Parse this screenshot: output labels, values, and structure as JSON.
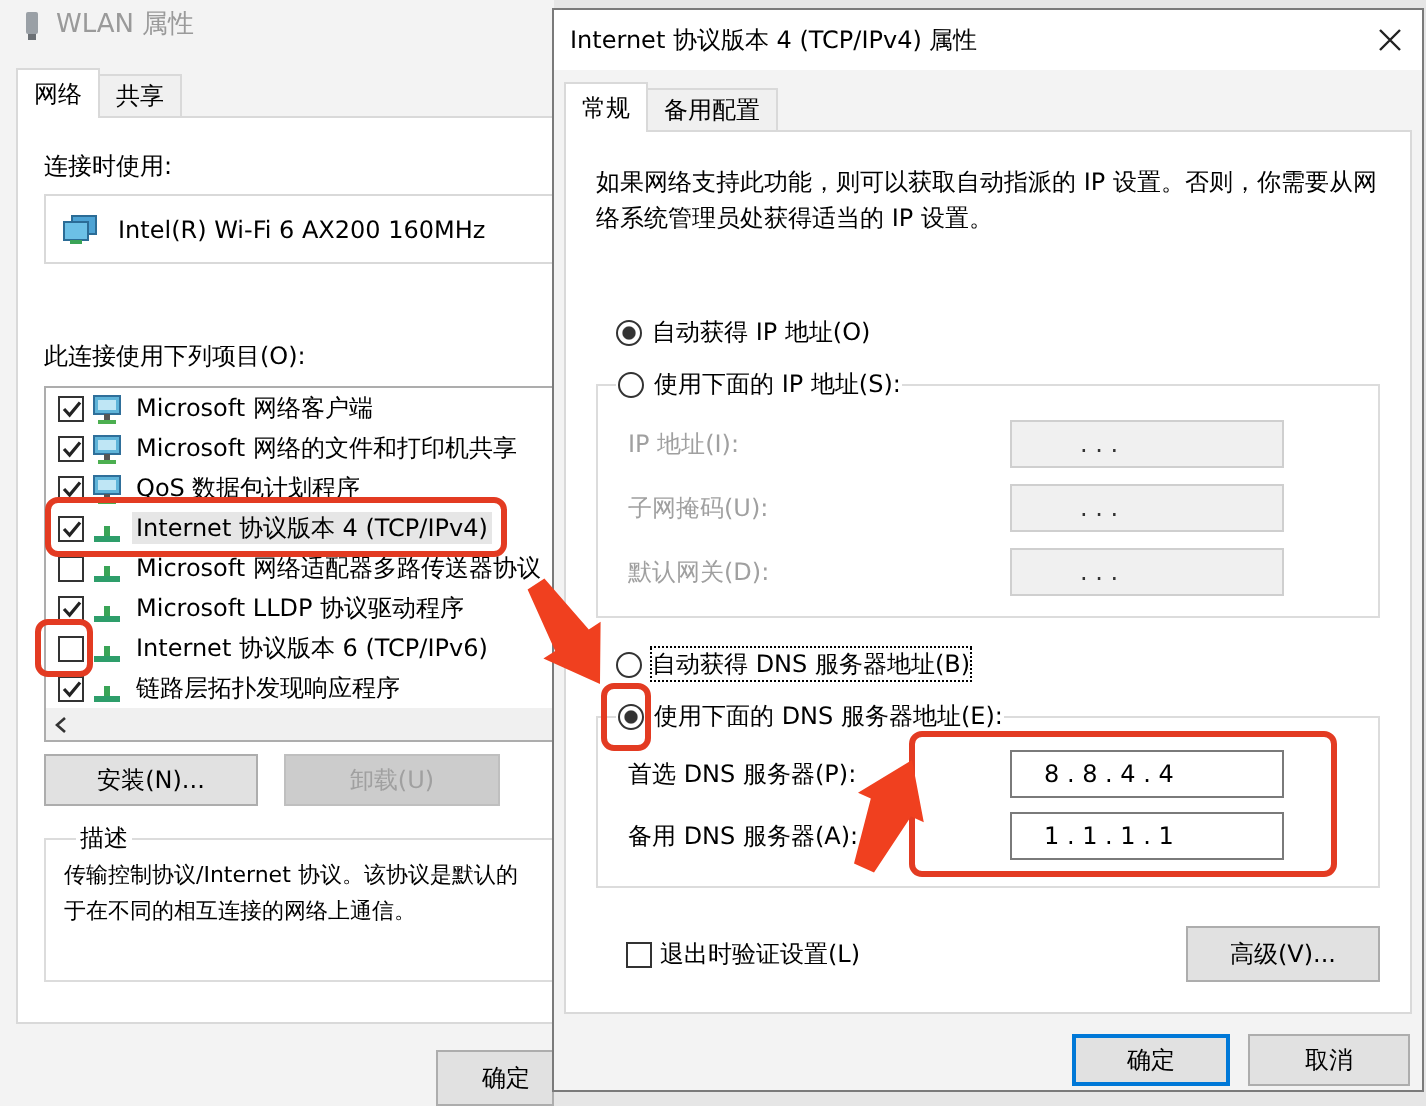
{
  "wlan_window": {
    "title": "WLAN 属性",
    "tabs": [
      {
        "label": "网络",
        "selected": true
      },
      {
        "label": "共享",
        "selected": false
      }
    ],
    "connect_using_label": "连接时使用:",
    "adapter": "Intel(R) Wi-Fi 6 AX200 160MHz",
    "items_label": "此连接使用下列项目(O):",
    "items": [
      {
        "kind": "client",
        "label": "Microsoft 网络客户端",
        "checked": true,
        "selected": false
      },
      {
        "kind": "client",
        "label": "Microsoft 网络的文件和打印机共享",
        "checked": true,
        "selected": false
      },
      {
        "kind": "client",
        "label": "QoS 数据包计划程序",
        "checked": true,
        "selected": false
      },
      {
        "kind": "protocol",
        "label": "Internet 协议版本 4 (TCP/IPv4)",
        "checked": true,
        "selected": true
      },
      {
        "kind": "protocol",
        "label": "Microsoft 网络适配器多路传送器协议",
        "checked": false,
        "selected": false
      },
      {
        "kind": "protocol",
        "label": "Microsoft LLDP 协议驱动程序",
        "checked": true,
        "selected": false
      },
      {
        "kind": "protocol",
        "label": "Internet 协议版本 6 (TCP/IPv6)",
        "checked": false,
        "selected": false
      },
      {
        "kind": "protocol",
        "label": "链路层拓扑发现响应程序",
        "checked": true,
        "selected": false
      }
    ],
    "buttons": [
      {
        "label": "安装(N)...",
        "disabled": false
      },
      {
        "label": "卸载(U)",
        "disabled": true
      }
    ],
    "description_title": "描述",
    "description_lines": [
      "传输控制协议/Internet 协议。该协议是默认的",
      "于在不同的相互连接的网络上通信。"
    ],
    "ok_button": "确定"
  },
  "ipv4_window": {
    "title": "Internet 协议版本 4 (TCP/IPv4) 属性",
    "tabs": [
      {
        "label": "常规",
        "selected": true
      },
      {
        "label": "备用配置",
        "selected": false
      }
    ],
    "intro": "如果网络支持此功能，则可以获取自动指派的 IP 设置。否则，你需要从网络系统管理员处获得适当的 IP 设置。",
    "ip_modes": [
      {
        "label": "自动获得 IP 地址(O)",
        "selected": true,
        "focused": false
      },
      {
        "label": "使用下面的 IP 地址(S):",
        "selected": false,
        "focused": false
      }
    ],
    "ip_fields": [
      {
        "label": "IP 地址(I):",
        "value": ". . .",
        "disabled": true
      },
      {
        "label": "子网掩码(U):",
        "value": ". . .",
        "disabled": true
      },
      {
        "label": "默认网关(D):",
        "value": ". . .",
        "disabled": true
      }
    ],
    "dns_modes": [
      {
        "label": "自动获得 DNS 服务器地址(B)",
        "selected": false,
        "focused": true
      },
      {
        "label": "使用下面的 DNS 服务器地址(E):",
        "selected": true,
        "focused": false
      }
    ],
    "dns_fields": [
      {
        "label": "首选 DNS 服务器(P):",
        "value": "8 . 8 . 4 . 4",
        "disabled": false
      },
      {
        "label": "备用 DNS 服务器(A):",
        "value": "1 . 1 . 1 . 1",
        "disabled": false
      }
    ],
    "validate_on_exit": {
      "label": "退出时验证设置(L)",
      "checked": false
    },
    "advanced_button": "高级(V)...",
    "buttons": [
      {
        "label": "确定",
        "default": true
      },
      {
        "label": "取消",
        "default": false
      }
    ]
  }
}
